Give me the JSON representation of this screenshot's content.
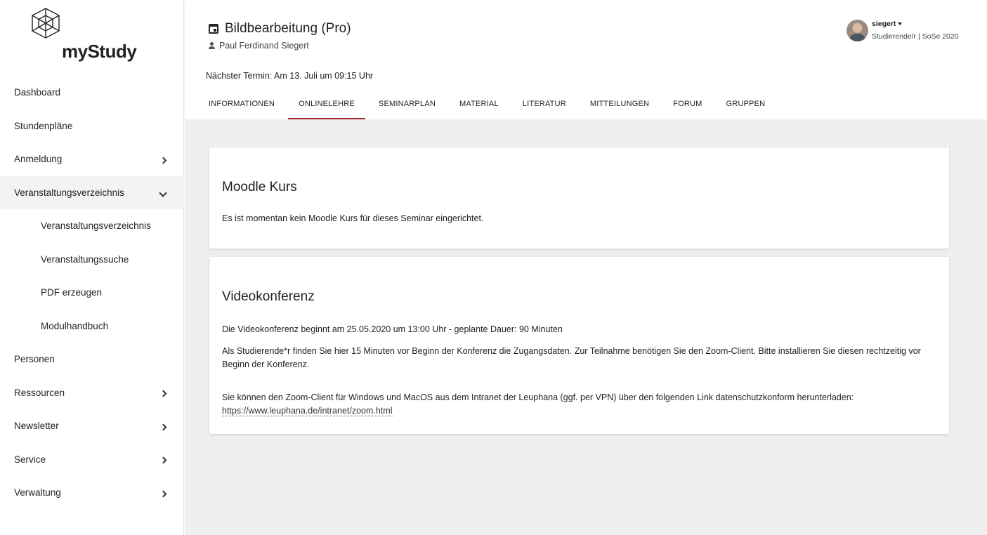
{
  "logo": {
    "text": "myStudy",
    "icon": "cube-logo-icon"
  },
  "sidebar": {
    "items": [
      {
        "label": "Dashboard",
        "chevron": ""
      },
      {
        "label": "Stundenpläne",
        "chevron": ""
      },
      {
        "label": "Anmeldung",
        "chevron": "right"
      },
      {
        "label": "Veranstaltungsverzeichnis",
        "chevron": "down"
      },
      {
        "label": "Veranstaltungsverzeichnis",
        "chevron": "",
        "sub": true
      },
      {
        "label": "Veranstaltungssuche",
        "chevron": "",
        "sub": true
      },
      {
        "label": "PDF erzeugen",
        "chevron": "",
        "sub": true
      },
      {
        "label": "Modulhandbuch",
        "chevron": "",
        "sub": true
      },
      {
        "label": "Personen",
        "chevron": ""
      },
      {
        "label": "Ressourcen",
        "chevron": "right"
      },
      {
        "label": "Newsletter",
        "chevron": "right"
      },
      {
        "label": "Service",
        "chevron": "right"
      },
      {
        "label": "Verwaltung",
        "chevron": "right"
      }
    ]
  },
  "header": {
    "course_title": "Bildbearbeitung (Pro)",
    "teacher": "Paul Ferdinand Siegert",
    "next_date": "Nächster Termin: Am 13. Juli um 09:15 Uhr",
    "tabs": [
      {
        "label": "INFORMATIONEN"
      },
      {
        "label": "ONLINELEHRE",
        "active": true
      },
      {
        "label": "SEMINARPLAN"
      },
      {
        "label": "MATERIAL"
      },
      {
        "label": "LITERATUR"
      },
      {
        "label": "MITTEILUNGEN"
      },
      {
        "label": "FORUM"
      },
      {
        "label": "GRUPPEN"
      }
    ]
  },
  "user": {
    "name": "siegert",
    "role": "Studierende/r | SoSe 2020"
  },
  "cards": {
    "moodle": {
      "title": "Moodle Kurs",
      "text": "Es ist momentan kein Moodle Kurs für dieses Seminar eingerichtet."
    },
    "video": {
      "title": "Videokonferenz",
      "line1": "Die Videokonferenz beginnt am 25.05.2020 um 13:00 Uhr - geplante Dauer: 90 Minuten",
      "line2": "Als Studierende*r finden Sie hier 15 Minuten vor Beginn der Konferenz die Zugangsdaten. Zur Teilnahme benötigen Sie den Zoom-Client. Bitte installieren Sie diesen rechtzeitig vor Beginn der Konferenz.",
      "line3": "Sie können den Zoom-Client für Windows und MacOS aus dem Intranet der Leuphana (ggf. per VPN) über den folgenden Link datenschutzkonform herunterladen:",
      "link": "https://www.leuphana.de/intranet/zoom.html"
    }
  },
  "colors": {
    "accent": "#a0282e",
    "background": "#efefef"
  }
}
